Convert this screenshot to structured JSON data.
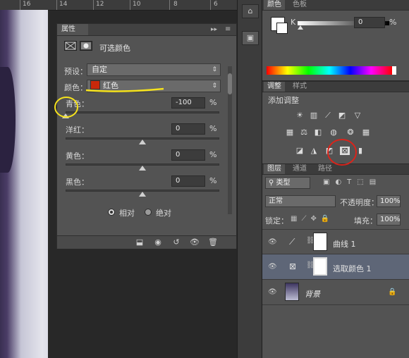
{
  "ruler": {
    "labels": [
      "16",
      "14",
      "12",
      "10",
      "8",
      "6"
    ]
  },
  "properties": {
    "tab": "属性",
    "title": "可选颜色",
    "preset_label": "预设：",
    "preset_value": "自定",
    "colors_label": "颜色：",
    "colors_value": "红色",
    "colors_swatch": "#c8280a",
    "sliders": [
      {
        "label": "青色：",
        "value": "-100",
        "unit": "%",
        "level": 0.0
      },
      {
        "label": "洋红：",
        "value": "0",
        "unit": "%",
        "level": 0.5
      },
      {
        "label": "黄色：",
        "value": "0",
        "unit": "%",
        "level": 0.5
      },
      {
        "label": "黑色：",
        "value": "0",
        "unit": "%",
        "level": 0.5
      }
    ],
    "method_relative": "相对",
    "method_absolute": "绝对",
    "method_selected": "相对",
    "footer_icons": [
      "clip-to-layer-icon",
      "view-previous-icon",
      "reset-icon",
      "visibility-icon",
      "delete-icon"
    ]
  },
  "color_panel": {
    "tabs": [
      "颜色",
      "色板"
    ],
    "channel_label": "K",
    "channel_value": "0",
    "unit": "%"
  },
  "adjustments": {
    "tabs": [
      "调整",
      "样式"
    ],
    "title": "添加调整"
  },
  "layers": {
    "tabs": [
      "图层",
      "通道",
      "路径"
    ],
    "filter_value": "类型",
    "blend_mode": "正常",
    "opacity_label": "不透明度：",
    "opacity_value": "100%",
    "lock_label": "锁定：",
    "fill_label": "填充：",
    "fill_value": "100%",
    "items": [
      {
        "name": "曲线 1"
      },
      {
        "name": "选取颜色 1"
      },
      {
        "name": "背景"
      }
    ]
  },
  "annotations": {
    "underline_color": "#f5e21c",
    "circle_yellow": "#f5e21c",
    "circle_red": "#d9241b"
  }
}
